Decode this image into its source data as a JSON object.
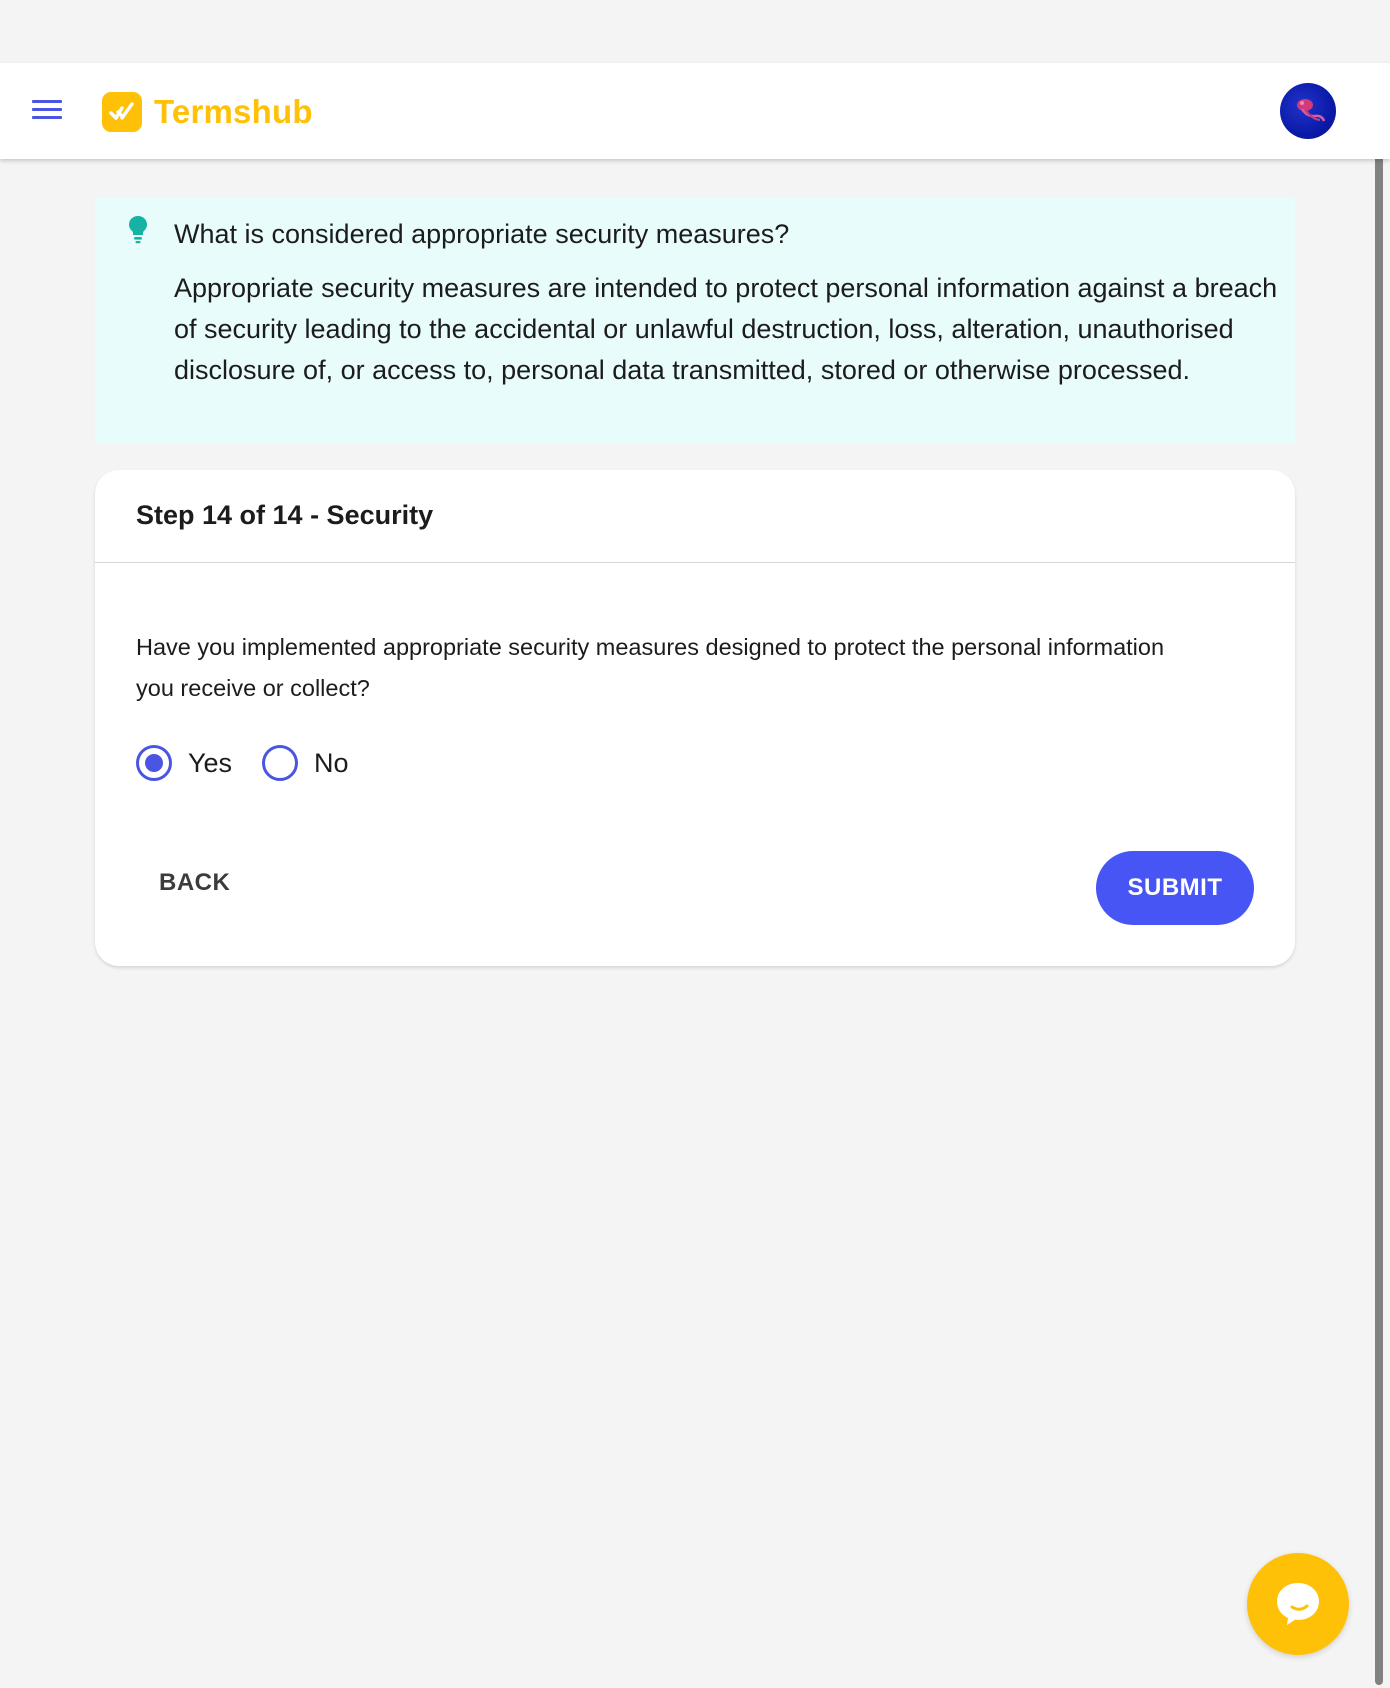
{
  "app": {
    "brand": "Termshub",
    "menu_icon": "hamburger-menu-icon",
    "avatar_icon": "user-avatar",
    "accent_color": "#4a56e2",
    "brand_color": "#ffc107"
  },
  "tip": {
    "icon": "lightbulb-icon",
    "title": "What is considered appropriate security measures?",
    "body": "Appropriate security measures are intended to protect personal information against a breach of security leading to the accidental or unlawful destruction, loss, alteration, unauthorised disclosure of, or access to, personal data transmitted, stored or otherwise processed."
  },
  "step": {
    "title": "Step 14 of 14 - Security",
    "question": "Have you implemented appropriate security measures designed to protect the personal information you receive or collect?",
    "options": [
      {
        "label": "Yes",
        "selected": true
      },
      {
        "label": "No",
        "selected": false
      }
    ],
    "back_label": "BACK",
    "submit_label": "SUBMIT"
  },
  "chat": {
    "icon": "chat-bubble-icon"
  }
}
